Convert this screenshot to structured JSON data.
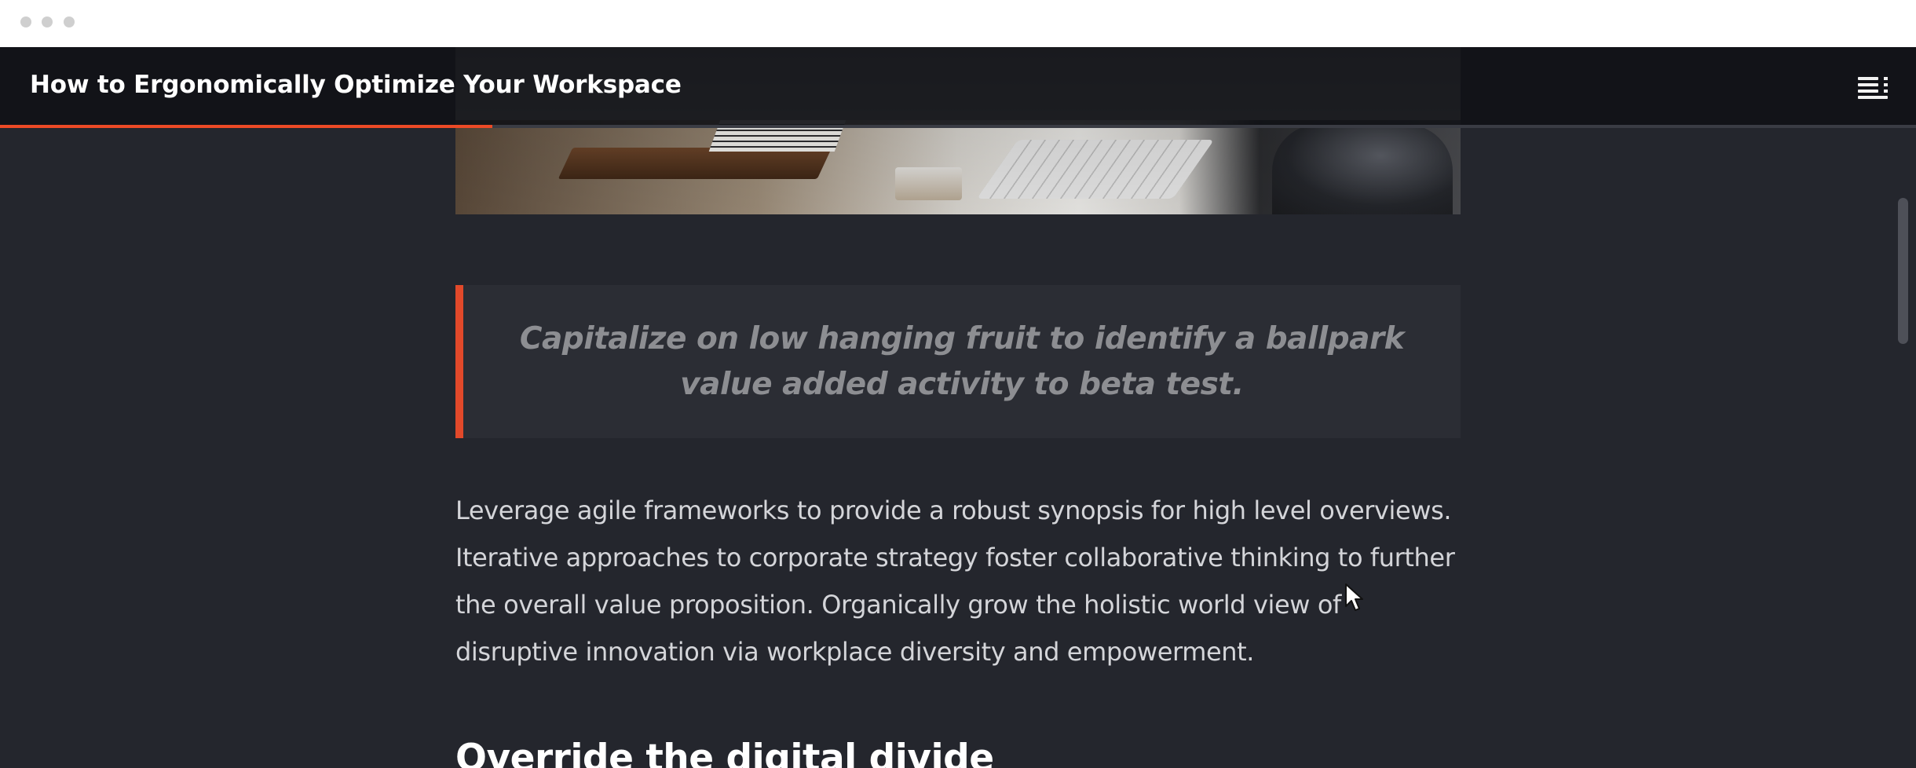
{
  "header": {
    "title": "How to Ergonomically Optimize Your Workspace",
    "reading_progress_percent": 25.7,
    "toc_icon": "table-of-contents-icon"
  },
  "article": {
    "quote": "Capitalize on low hanging fruit to identify a ballpark value added activity to beta test.",
    "paragraph": "Leverage agile frameworks to provide a robust synopsis for high level overviews. Iterative approaches to corporate strategy foster collaborative thinking to further the overall value proposition. Organically grow the holistic world view of disruptive innovation via workplace diversity and empowerment.",
    "next_heading": "Override the digital divide"
  },
  "colors": {
    "accent": "#ec4a26",
    "background": "#24262d",
    "quote_background": "#2b2d34"
  }
}
